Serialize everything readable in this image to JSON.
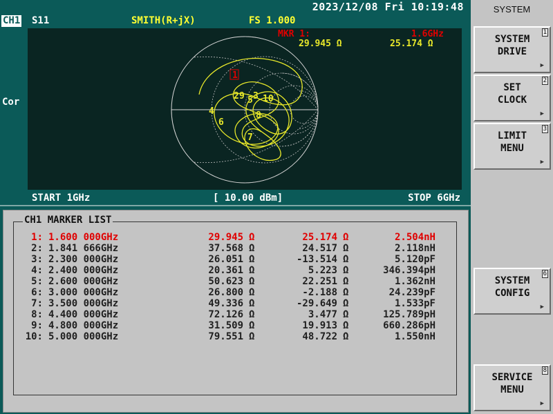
{
  "header": {
    "datetime": "2023/12/08 Fri 10:19:48",
    "channel": "CH1",
    "parameter": "S11",
    "format": "SMITH(R+jX)",
    "fs": "FS   1.000",
    "side_label": "Cor"
  },
  "marker_readout": {
    "label": "MKR  1:",
    "freq": "1.6GHz",
    "resistance": "29.945 Ω",
    "reactance": "25.174 Ω"
  },
  "footer": {
    "start": "START 1GHz",
    "power": "[ 10.00 dBm]",
    "stop": "STOP 6GHz"
  },
  "marker_list": {
    "title": "CH1 MARKER LIST",
    "rows": [
      {
        "idx": "1:",
        "freq": "1.600 000GHz",
        "r": "29.945",
        "x": "25.174",
        "lc": "2.504nH"
      },
      {
        "idx": "2:",
        "freq": "1.841 666GHz",
        "r": "37.568",
        "x": "24.517",
        "lc": "2.118nH"
      },
      {
        "idx": "3:",
        "freq": "2.300 000GHz",
        "r": "26.051",
        "x": "-13.514",
        "lc": "5.120pF"
      },
      {
        "idx": "4:",
        "freq": "2.400 000GHz",
        "r": "20.361",
        "x": "5.223",
        "lc": "346.394pH"
      },
      {
        "idx": "5:",
        "freq": "2.600 000GHz",
        "r": "50.623",
        "x": "22.251",
        "lc": "1.362nH"
      },
      {
        "idx": "6:",
        "freq": "3.000 000GHz",
        "r": "26.800",
        "x": "-2.188",
        "lc": "24.239pF"
      },
      {
        "idx": "7:",
        "freq": "3.500 000GHz",
        "r": "49.336",
        "x": "-29.649",
        "lc": "1.533pF"
      },
      {
        "idx": "8:",
        "freq": "4.400 000GHz",
        "r": "72.126",
        "x": "3.477",
        "lc": "125.789pH"
      },
      {
        "idx": "9:",
        "freq": "4.800 000GHz",
        "r": "31.509",
        "x": "19.913",
        "lc": "660.286pH"
      },
      {
        "idx": "10:",
        "freq": "5.000 000GHz",
        "r": "79.551",
        "x": "48.722",
        "lc": "1.550nH"
      }
    ],
    "ohm": "Ω",
    "active_index": 0
  },
  "sidebar": {
    "title": "SYSTEM",
    "softkeys": [
      {
        "num": "1",
        "label": "SYSTEM\nDRIVE"
      },
      {
        "num": "2",
        "label": "SET\nCLOCK"
      },
      {
        "num": "3",
        "label": "LIMIT\nMENU"
      },
      {
        "num": "6",
        "label": "SYSTEM\nCONFIG"
      },
      {
        "num": "8",
        "label": "SERVICE\nMENU"
      }
    ],
    "arrow": "▶"
  },
  "colors": {
    "background": "#0b5a58",
    "trace": "#e8e82a",
    "marker_active": "#e00000",
    "softkey": "#cfcfcf"
  }
}
